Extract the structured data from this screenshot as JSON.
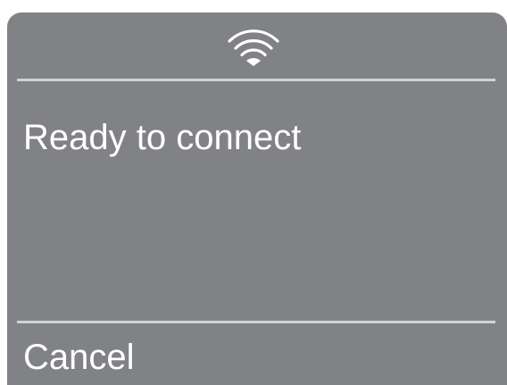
{
  "dialog": {
    "status_icon": "wifi-icon",
    "status_text": "Ready to connect",
    "cancel_label": "Cancel"
  },
  "colors": {
    "panel_background": "#818285",
    "divider": "#d2d3d5",
    "text": "#ffffff"
  }
}
